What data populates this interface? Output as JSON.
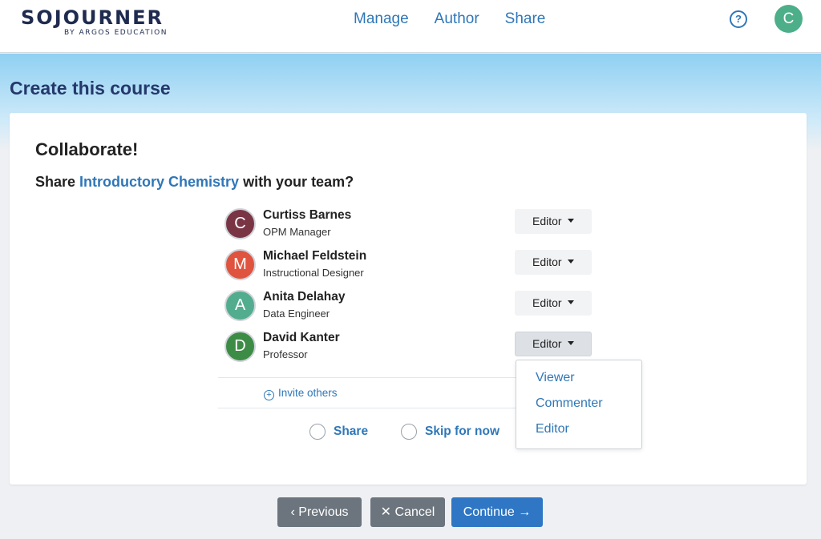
{
  "header": {
    "logo_main": "SOJOURNER",
    "logo_sub": "BY ARGOS EDUCATION",
    "nav": [
      "Manage",
      "Author",
      "Share"
    ],
    "help_glyph": "?",
    "user_initial": "C"
  },
  "page_title": "Create this course",
  "card": {
    "heading": "Collaborate!",
    "question_prefix": "Share ",
    "course_name": "Introductory Chemistry",
    "question_suffix": " with your team?",
    "members": [
      {
        "initial": "C",
        "name": "Curtiss Barnes",
        "role": "OPM Manager",
        "permission": "Editor",
        "color": "#7a3545"
      },
      {
        "initial": "M",
        "name": "Michael Feldstein",
        "role": "Instructional Designer",
        "permission": "Editor",
        "color": "#e0533f"
      },
      {
        "initial": "A",
        "name": "Anita Delahay",
        "role": "Data Engineer",
        "permission": "Editor",
        "color": "#52ad8e"
      },
      {
        "initial": "D",
        "name": "David Kanter",
        "role": "Professor",
        "permission": "Editor",
        "color": "#3c8c45"
      }
    ],
    "invite_label": "Invite others",
    "share_option": "Share",
    "skip_option": "Skip for now"
  },
  "dropdown": {
    "options": [
      "Viewer",
      "Commenter",
      "Editor"
    ]
  },
  "footer": {
    "previous": "Previous",
    "cancel": "Cancel",
    "continue": "Continue"
  },
  "colors": {
    "accent": "#2f77b8",
    "title": "#24386b",
    "secondary_button": "#6c757d",
    "primary_button": "#2f77c4"
  }
}
